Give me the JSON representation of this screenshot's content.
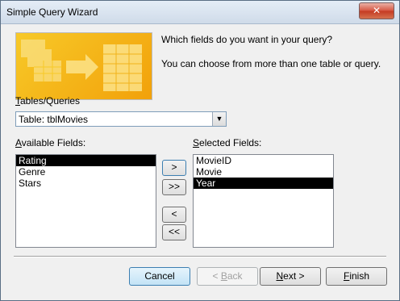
{
  "window": {
    "title": "Simple Query Wizard",
    "close_label": "✕"
  },
  "header": {
    "prompt_question": "Which fields do you want in your query?",
    "prompt_hint": "You can choose from more than one table or query."
  },
  "tables": {
    "label_underlined": "T",
    "label_rest": "ables/Queries",
    "selected_value": "Table: tblMovies"
  },
  "available": {
    "label_underlined": "A",
    "label_rest": "vailable Fields:",
    "items": [
      "Rating",
      "Genre",
      "Stars"
    ],
    "selected_index": 0
  },
  "selected": {
    "label_underlined": "S",
    "label_rest": "elected Fields:",
    "items": [
      "MovieID",
      "Movie",
      "Year"
    ],
    "selected_index": 2
  },
  "move_buttons": {
    "add_one": ">",
    "add_all": ">>",
    "remove_one": "<",
    "remove_all": "<<"
  },
  "footer": {
    "cancel": "Cancel",
    "back_prefix": "< ",
    "back_underlined": "B",
    "back_rest": "ack",
    "next_underlined": "N",
    "next_rest": "ext >",
    "finish_underlined": "F",
    "finish_rest": "inish"
  },
  "colors": {
    "banner_accent": "#f2a10a",
    "selection": "#000000",
    "titlebar": "#dce6f2"
  },
  "icons": {
    "banner": "query-wizard-graphic",
    "dropdown": "chevron-down-icon"
  }
}
